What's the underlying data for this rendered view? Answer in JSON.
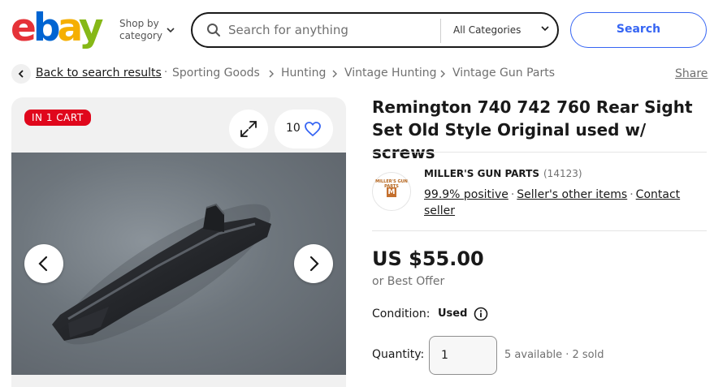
{
  "header": {
    "logo_letters": [
      "e",
      "b",
      "a",
      "y"
    ],
    "logo_colors": [
      "#e53238",
      "#0064d2",
      "#f5af02",
      "#86b817"
    ],
    "shop_by_line1": "Shop by",
    "shop_by_line2": "category",
    "search_placeholder": "Search for anything",
    "category_select": "All Categories",
    "search_button": "Search"
  },
  "breadcrumb": {
    "back": "Back to search results",
    "items": [
      "Sporting Goods",
      "Hunting",
      "Vintage Hunting",
      "Vintage Gun Parts"
    ],
    "share": "Share"
  },
  "gallery": {
    "badge": "IN 1 CART",
    "watch_count": "10",
    "badge_color": "#e0071c"
  },
  "listing": {
    "title": "Remington 740 742 760 Rear Sight Set Old Style Original used w/ screws",
    "seller": {
      "name": "MILLER'S GUN PARTS",
      "feedback_count": "(14123)",
      "positive": "99.9% positive",
      "other_items": "Seller's other items",
      "contact": "Contact seller",
      "logo_text": "MILLER'S GUN PARTS",
      "logo_letter": "M"
    },
    "price": "US $55.00",
    "best_offer": "or Best Offer",
    "condition_label": "Condition:",
    "condition_value": "Used",
    "quantity_label": "Quantity:",
    "quantity_value": "1",
    "availability": "5 available · 2 sold"
  },
  "icons": {
    "search": "search-icon",
    "chevron": "chevron-down-icon",
    "back": "chevron-left-icon",
    "expand": "expand-icon",
    "heart": "heart-icon",
    "info": "info-icon",
    "prev": "chevron-left-icon",
    "next": "chevron-right-icon"
  },
  "colors": {
    "accent": "#3665f3",
    "badge": "#e0071c"
  }
}
